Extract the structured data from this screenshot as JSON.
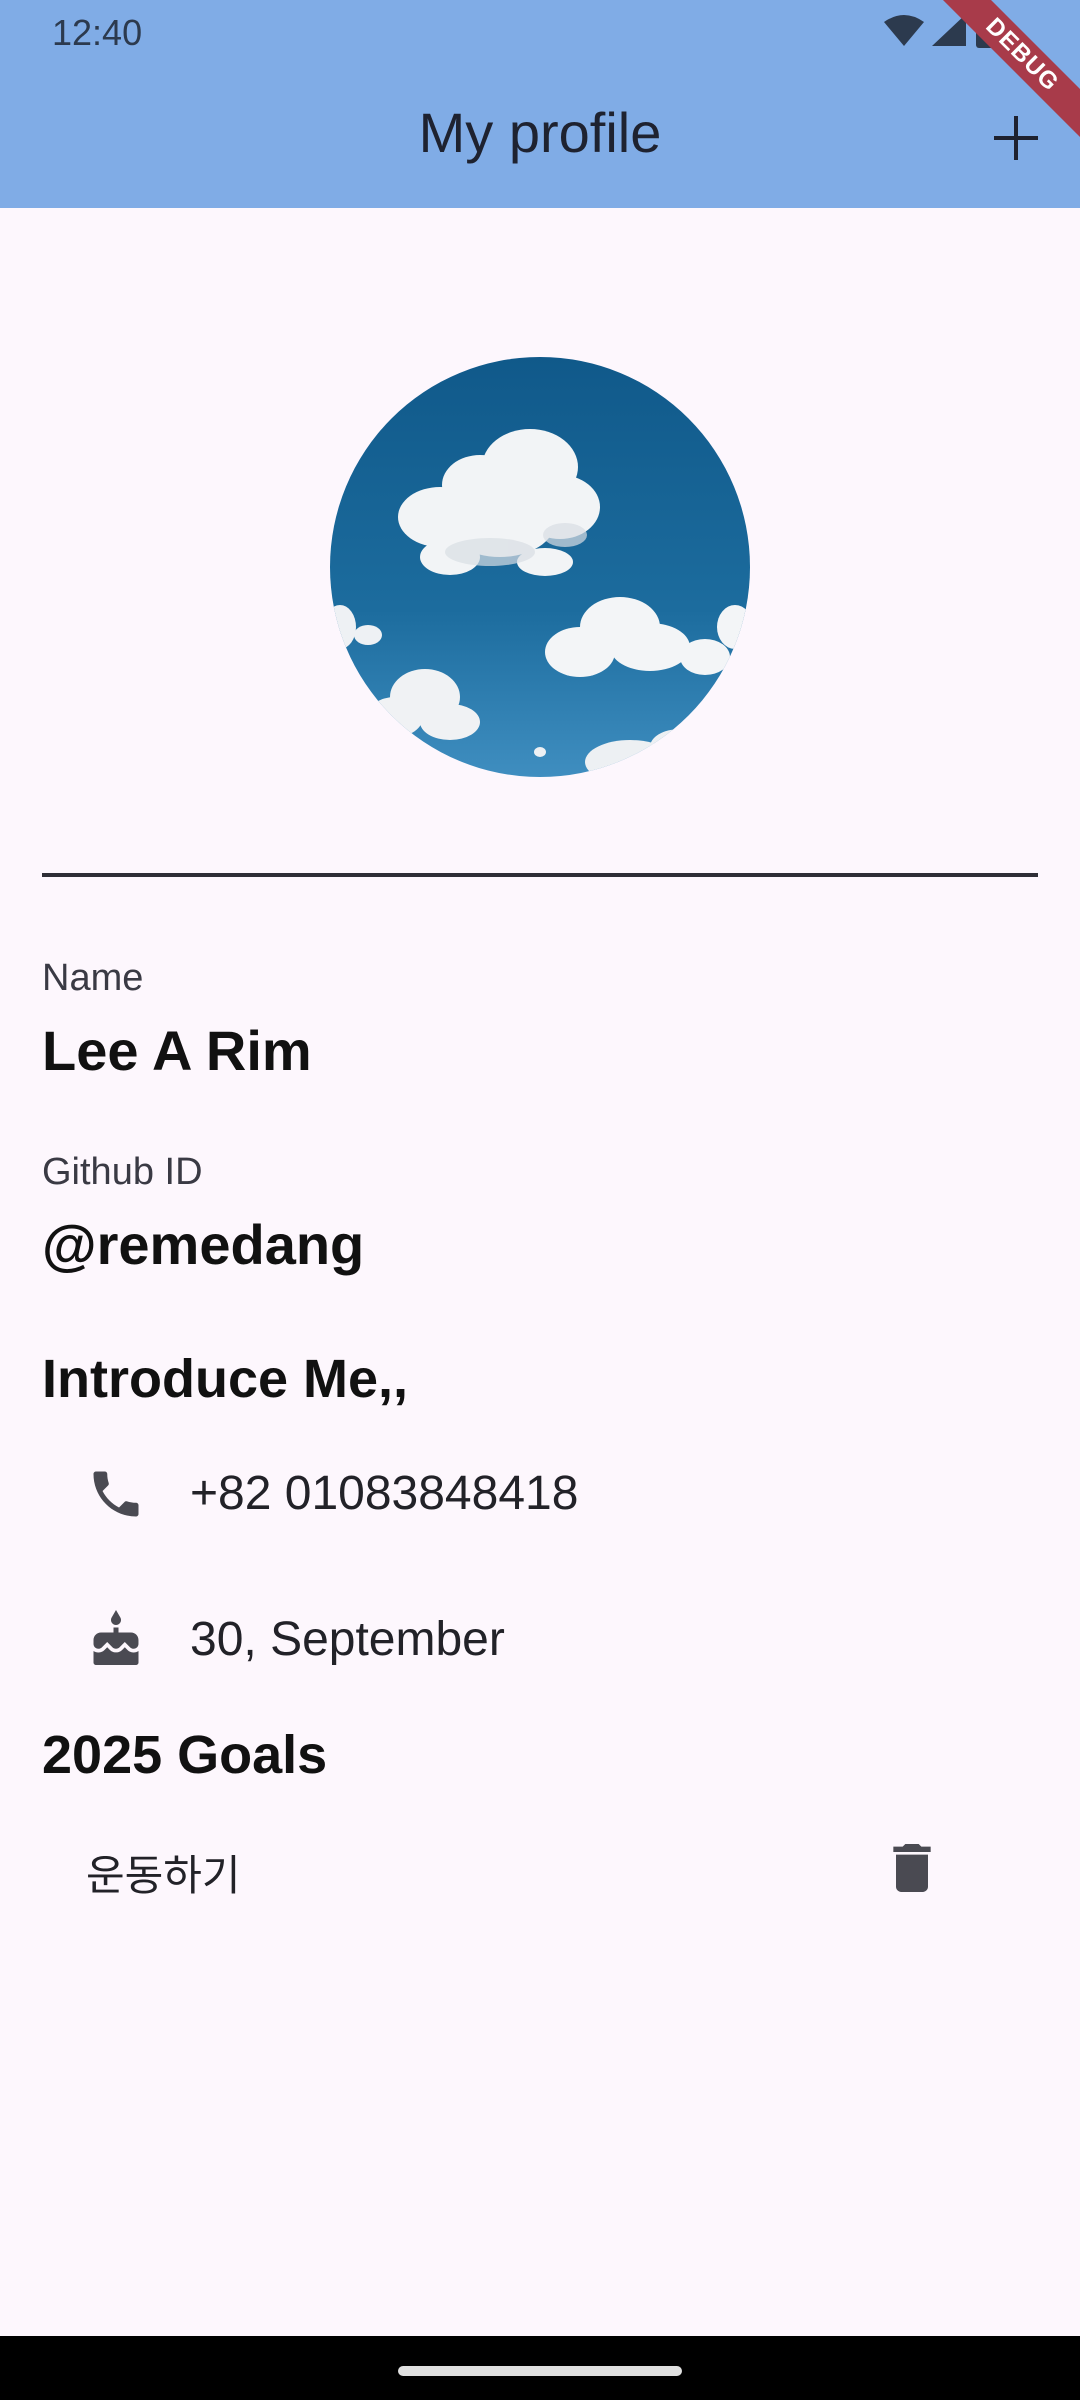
{
  "status_bar": {
    "time": "12:40",
    "icons": [
      "wifi-icon",
      "signal-icon",
      "battery-icon"
    ]
  },
  "debug_banner": {
    "label": "DEBUG"
  },
  "appbar": {
    "title": "My profile",
    "action_icon": "plus-icon",
    "background": "#80ACE6"
  },
  "profile": {
    "avatar_description": "cloud-sky-image",
    "name_label": "Name",
    "name_value": "Lee A Rim",
    "github_label": "Github ID",
    "github_value": "@remedang"
  },
  "introduce": {
    "title": "Introduce Me,,",
    "items": [
      {
        "icon": "phone-icon",
        "text": "+82 01083848418"
      },
      {
        "icon": "cake-icon",
        "text": "30, September"
      }
    ]
  },
  "goals": {
    "title": "2025 Goals",
    "items": [
      {
        "text": "운동하기",
        "action_icon": "delete-icon"
      }
    ]
  },
  "colors": {
    "page_background": "#FDF7FD",
    "icon_color": "#4A4A52"
  }
}
